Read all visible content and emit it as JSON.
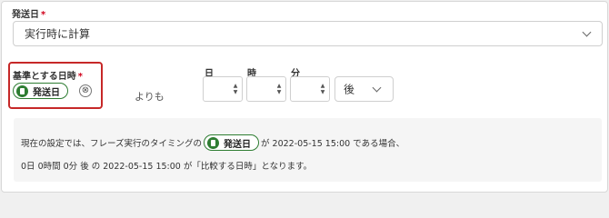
{
  "ship_date_field": {
    "label": "発送日",
    "required_mark": "*",
    "selected_value": "実行時に計算"
  },
  "base_datetime": {
    "label": "基準とする日時",
    "required_mark": "*",
    "chip_label": "発送日",
    "remove_icon": "⊗"
  },
  "yorimo": "よりも",
  "offset": {
    "day_label": "日",
    "hour_label": "時",
    "minute_label": "分",
    "day_value": "",
    "hour_value": "",
    "minute_value": "",
    "direction_value": "後"
  },
  "info": {
    "line1_before": "現在の設定では、フレーズ実行のタイミングの",
    "line1_chip": "発送日",
    "line1_after": "が 2022-05-15 15:00 である場合、",
    "line2": "0日 0時間 0分 後 の 2022-05-15 15:00 が「比較する日時」となります。"
  },
  "colors": {
    "required": "#d0021b",
    "highlight": "#c62828",
    "chip_accent": "#2e7d32"
  }
}
